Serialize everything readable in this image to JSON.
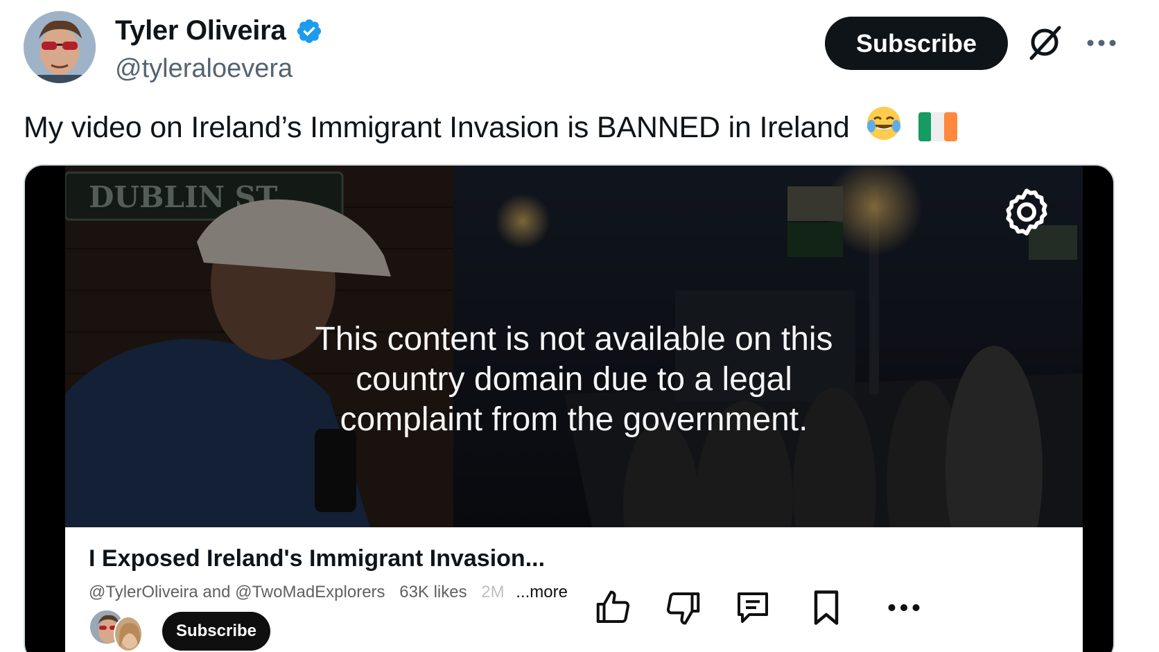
{
  "author": {
    "display_name": "Tyler Oliveira",
    "handle": "@tyleraloevera",
    "verified": true,
    "verified_color": "#1d9bf0"
  },
  "header_actions": {
    "subscribe_label": "Subscribe",
    "grok_icon": "grok-icon",
    "more_icon": "more-dots-icon"
  },
  "tweet": {
    "text": "My video on Ireland’s Immigrant Invasion is BANNED in Ireland",
    "emojis": [
      "face-with-tears-of-joy-emoji",
      "ireland-flag-emoji"
    ]
  },
  "media": {
    "sign_text": "DUBLIN ST",
    "notice": "This content is not available on this country domain due to a legal complaint from the government.",
    "settings_icon": "gear-icon",
    "video": {
      "title": "I Exposed Ireland's Immigrant Invasion...",
      "channels": "@TylerOliveira and @TwoMadExplorers",
      "likes": "63K likes",
      "views_partial": "2M",
      "more_label": "...more",
      "subscribe_label": "Subscribe",
      "actions": [
        "like-icon",
        "dislike-icon",
        "comment-icon",
        "save-icon",
        "more-dots-icon"
      ]
    }
  }
}
